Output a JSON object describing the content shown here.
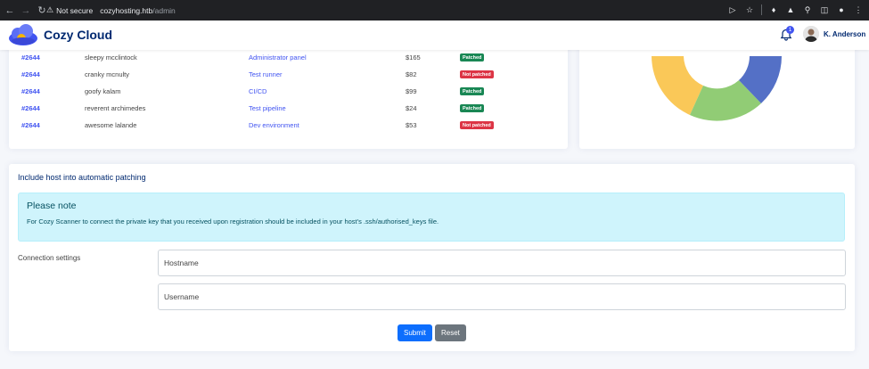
{
  "browser": {
    "security_label": "Not secure",
    "url_host": "cozyhosting.htb",
    "url_path": "/admin"
  },
  "app": {
    "brand": "Cozy Cloud",
    "notification_count": "1",
    "user_name": "K. Anderson"
  },
  "table": {
    "rows": [
      {
        "id": "#2644",
        "name": "sleepy mcclintock",
        "product": "Administrator panel",
        "price": "$165",
        "status": "Patched",
        "patched": true
      },
      {
        "id": "#2644",
        "name": "cranky mcnulty",
        "product": "Test runner",
        "price": "$82",
        "status": "Not patched",
        "patched": false
      },
      {
        "id": "#2644",
        "name": "goofy kalam",
        "product": "CI/CD",
        "price": "$99",
        "status": "Patched",
        "patched": true
      },
      {
        "id": "#2644",
        "name": "reverent archimedes",
        "product": "Test pipeline",
        "price": "$24",
        "status": "Patched",
        "patched": true
      },
      {
        "id": "#2644",
        "name": "awesome lalande",
        "product": "Dev environment",
        "price": "$53",
        "status": "Not patched",
        "patched": false
      }
    ]
  },
  "donut": {
    "colors": {
      "yellow": "#fac858",
      "green": "#91cc75",
      "blue": "#5470c6"
    }
  },
  "form": {
    "title": "Include host into automatic patching",
    "alert_title": "Please note",
    "alert_text": "For Cozy Scanner to connect the private key that you received upon registration should be included in your host's .ssh/authorised_keys file.",
    "connection_label": "Connection settings",
    "hostname_placeholder": "Hostname",
    "username_placeholder": "Username",
    "submit_label": "Submit",
    "reset_label": "Reset"
  },
  "colors": {
    "brand": "#012970",
    "primary": "#0d6efd",
    "success": "#198754",
    "danger": "#dc3545",
    "info_bg": "#cff4fc"
  }
}
